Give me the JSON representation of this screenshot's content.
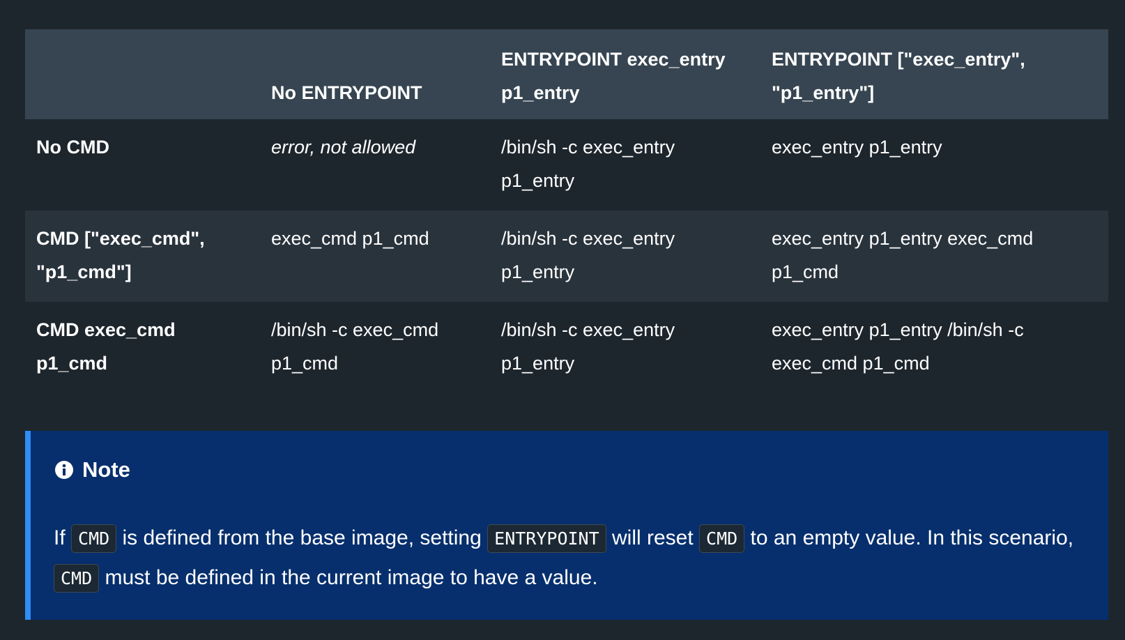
{
  "table": {
    "header": [
      "",
      "No ENTRYPOINT",
      "ENTRYPOINT exec_entry p1_entry",
      "ENTRYPOINT [\"exec_entry\", \"p1_entry\"]"
    ],
    "rows": [
      {
        "label": "No CMD",
        "cells": [
          "error, not allowed",
          "/bin/sh -c exec_entry p1_entry",
          "exec_entry p1_entry"
        ]
      },
      {
        "label": "CMD [\"exec_cmd\", \"p1_cmd\"]",
        "cells": [
          "exec_cmd p1_cmd",
          "/bin/sh -c exec_entry p1_entry",
          "exec_entry p1_entry exec_cmd p1_cmd"
        ]
      },
      {
        "label": "CMD exec_cmd p1_cmd",
        "cells": [
          "/bin/sh -c exec_cmd p1_cmd",
          "/bin/sh -c exec_entry p1_entry",
          "exec_entry p1_entry /bin/sh -c exec_cmd p1_cmd"
        ]
      }
    ]
  },
  "note": {
    "icon": "info-icon",
    "title": "Note",
    "text": {
      "p1": "If ",
      "code1": "CMD",
      "p2": " is defined from the base image, setting ",
      "code2": "ENTRYPOINT",
      "p3": " will reset ",
      "code3": "CMD",
      "p4": " to an empty value. In this scenario, ",
      "code4": "CMD",
      "p5": " must be defined in the current image to have a value."
    }
  },
  "colors": {
    "page_background": "#1e262d",
    "header_background": "#364551",
    "striped_row": "#29333c",
    "note_background": "#072f6d",
    "note_accent": "#2f8df5"
  }
}
